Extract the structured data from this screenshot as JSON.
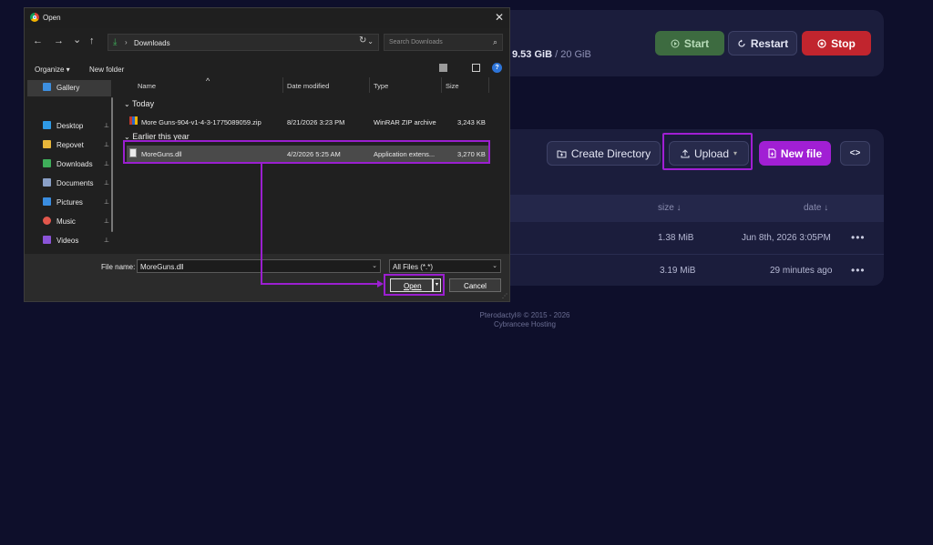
{
  "server": {
    "disk_used": "9.53 GiB",
    "disk_sep": " / ",
    "disk_total": "20 GiB",
    "start_label": "Start",
    "restart_label": "Restart",
    "stop_label": "Stop"
  },
  "files_toolbar": {
    "create_dir_label": "Create Directory",
    "upload_label": "Upload",
    "new_file_label": "New file",
    "code_label": "<>"
  },
  "file_table": {
    "headers": {
      "size": "size ↓",
      "date": "date ↓"
    },
    "rows": [
      {
        "size": "1.38 MiB",
        "date": "Jun 8th, 2026 3:05PM",
        "menu": "•••"
      },
      {
        "size": "3.19 MiB",
        "date": "29 minutes ago",
        "menu": "•••"
      }
    ]
  },
  "footer": {
    "line1": "Pterodactyl® © 2015 - 2026",
    "line2": "Cybrancee Hosting"
  },
  "dialog": {
    "title": "Open",
    "close": "✕",
    "nav": {
      "back": "←",
      "forward": "→",
      "recent": "⌄",
      "up": "↑"
    },
    "address": {
      "sep": "›",
      "location": "Downloads",
      "chevron": "⌄"
    },
    "refresh": "↻",
    "search_placeholder": "Search Downloads",
    "search_icon": "⌕",
    "organize_label": "Organize ▾",
    "new_folder_label": "New folder",
    "help": "?",
    "sidebar": [
      {
        "label": "Gallery",
        "color": "#3d8fe0",
        "pinned": false,
        "selected": true
      },
      {
        "label": "Desktop",
        "color": "#2f9ae6",
        "pinned": true,
        "selected": false
      },
      {
        "label": "Repovet",
        "color": "#e7b63a",
        "pinned": true,
        "selected": false
      },
      {
        "label": "Downloads",
        "color": "#3fae5a",
        "pinned": true,
        "selected": false
      },
      {
        "label": "Documents",
        "color": "#8aa0c7",
        "pinned": true,
        "selected": false
      },
      {
        "label": "Pictures",
        "color": "#3a8de0",
        "pinned": true,
        "selected": false
      },
      {
        "label": "Music",
        "color": "#e2574c",
        "pinned": true,
        "selected": false
      },
      {
        "label": "Videos",
        "color": "#8b54d8",
        "pinned": true,
        "selected": false
      }
    ],
    "pin_glyph": "📌",
    "columns": {
      "name": "Name",
      "date": "Date modified",
      "type": "Type",
      "size": "Size",
      "sort_glyph": "^"
    },
    "groups": [
      {
        "label": "Today",
        "files": [
          {
            "name": "More Guns-904-v1-4-3-1775089059.zip",
            "date": "8/21/2026 3:23 PM",
            "type": "WinRAR ZIP archive",
            "size": "3,243 KB",
            "icon": "zip-icon"
          }
        ]
      },
      {
        "label": "Earlier this year",
        "files": [
          {
            "name": "MoreGuns.dll",
            "date": "4/2/2026 5:25 AM",
            "type": "Application extens...",
            "size": "3,270 KB",
            "icon": "dll-icon"
          }
        ]
      }
    ],
    "filename_label": "File name:",
    "filename_value": "MoreGuns.dll",
    "filetype_value": "All Files (*.*)",
    "open_label": "Open",
    "cancel_label": "Cancel"
  },
  "colors": {
    "highlight": "#9b1fd0",
    "accent_purple": "#a11fd4",
    "stop_red": "#c1252e",
    "start_green": "#3d6b40"
  }
}
